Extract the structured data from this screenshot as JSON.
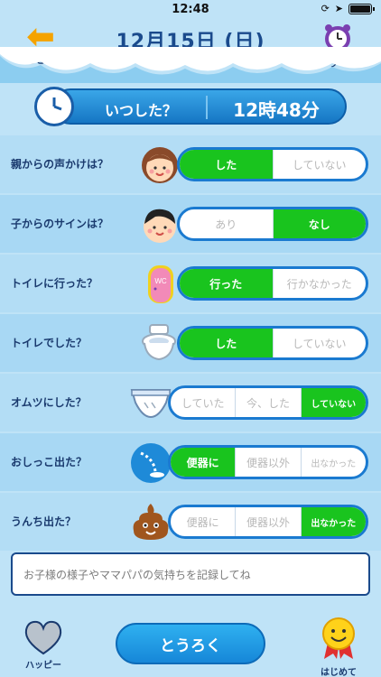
{
  "status": {
    "time": "12:48"
  },
  "header": {
    "back_label": "もどる",
    "date": "12月15日 (日)",
    "alarm_label": "アラーム"
  },
  "time_row": {
    "question": "いつした？",
    "value": "12時48分"
  },
  "questions": [
    {
      "label": "親からの声かけは？",
      "icon": "parent-face-icon",
      "options": [
        "した",
        "していない"
      ],
      "selected": 0
    },
    {
      "label": "子からのサインは？",
      "icon": "child-face-icon",
      "options": [
        "あり",
        "なし"
      ],
      "selected": 1
    },
    {
      "label": "トイレに行った？",
      "icon": "toilet-door-icon",
      "options": [
        "行った",
        "行かなかった"
      ],
      "selected": 0
    },
    {
      "label": "トイレでした？",
      "icon": "toilet-icon",
      "options": [
        "した",
        "していない"
      ],
      "selected": 0
    },
    {
      "label": "オムツにした？",
      "icon": "diaper-icon",
      "options": [
        "していた",
        "今、した",
        "していない"
      ],
      "selected": 2
    },
    {
      "label": "おしっこ出た？",
      "icon": "pee-drop-icon",
      "options": [
        "便器に",
        "便器以外",
        "出なかった"
      ],
      "selected": 0
    },
    {
      "label": "うんち出た？",
      "icon": "poop-icon",
      "options": [
        "便器に",
        "便器以外",
        "出なかった"
      ],
      "selected": 2
    }
  ],
  "memo": {
    "placeholder": "お子様の様子やママパパの気持ちを記録してね"
  },
  "footer": {
    "happy_label": "ハッピー",
    "register_label": "とうろく",
    "first_label": "はじめて"
  },
  "colors": {
    "selected": "#19c41e",
    "accent": "#1a7ad0",
    "background": "#bfe3f7"
  }
}
